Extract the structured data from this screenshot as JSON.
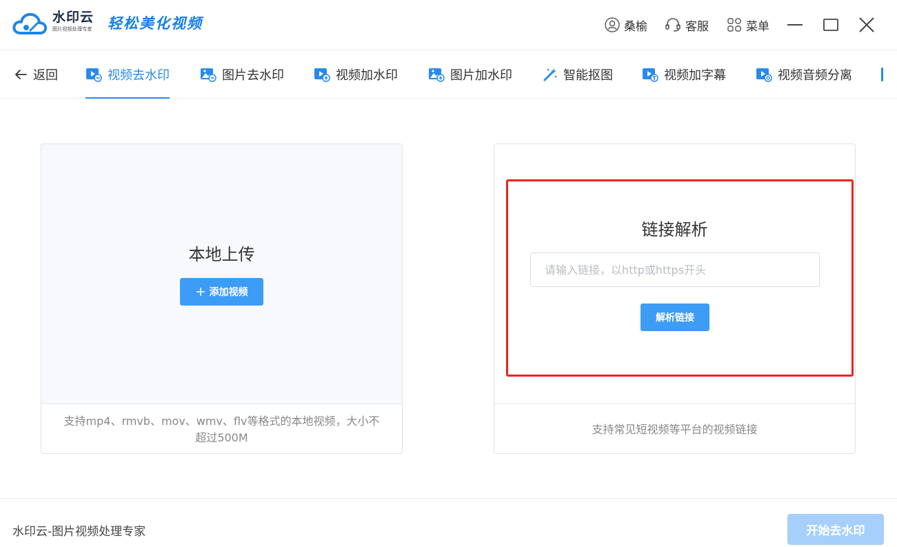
{
  "app": {
    "brand_name": "水印云",
    "brand_subtitle": "图片视频处理专家",
    "slogan": "轻松美化视频"
  },
  "titlebar": {
    "user_label": "桑榆",
    "service_label": "客服",
    "menu_label": "菜单"
  },
  "nav": {
    "back_label": "返回",
    "tabs": [
      {
        "label": "视频去水印",
        "active": true
      },
      {
        "label": "图片去水印"
      },
      {
        "label": "视频加水印"
      },
      {
        "label": "图片加水印"
      },
      {
        "label": "智能抠图"
      },
      {
        "label": "视频加字幕"
      },
      {
        "label": "视频音频分离"
      }
    ]
  },
  "local_upload": {
    "title": "本地上传",
    "button_label": "添加视频",
    "hint": "支持mp4、rmvb、mov、wmv、flv等格式的本地视频，大小不超过500M"
  },
  "link_parse": {
    "title": "链接解析",
    "input_value": "",
    "input_placeholder": "请输入链接，以http或https开头",
    "button_label": "解析链接",
    "hint": "支持常见短视频等平台的视频链接"
  },
  "footer": {
    "text": "水印云-图片视频处理专家",
    "start_button_label": "开始去水印"
  },
  "colors": {
    "accent": "#2a89ec",
    "button": "#3d9cf6",
    "button_disabled": "#a6d0fb",
    "highlight": "#e8251f"
  }
}
